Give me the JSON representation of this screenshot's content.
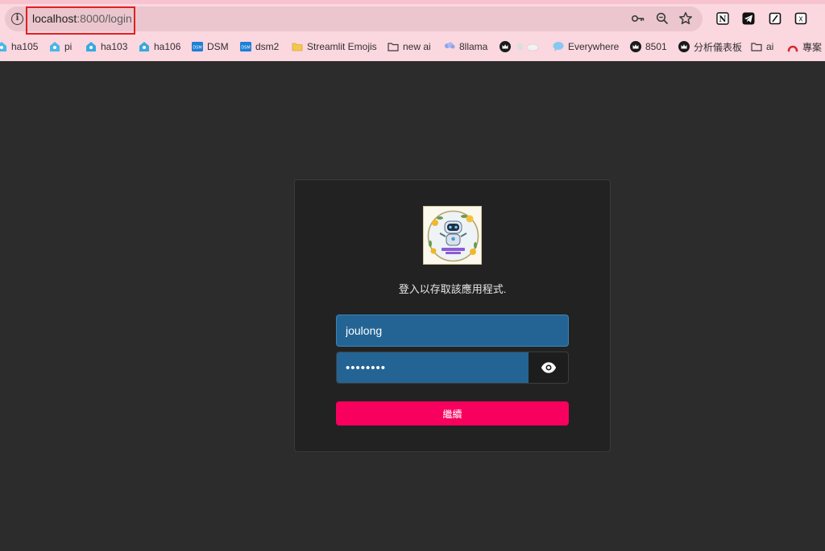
{
  "browser": {
    "url_host": "localhost",
    "url_rest": ":8000/login"
  },
  "bookmarks": [
    {
      "label": "ha105",
      "icon": "home-assistant-icon"
    },
    {
      "label": "pi",
      "icon": "home-assistant-icon"
    },
    {
      "label": "ha103",
      "icon": "home-assistant-icon"
    },
    {
      "label": "ha106",
      "icon": "home-assistant-icon"
    },
    {
      "label": "DSM",
      "icon": "dsm-icon"
    },
    {
      "label": "dsm2",
      "icon": "dsm-icon"
    },
    {
      "label": "Streamlit Emojis",
      "icon": "folder-yellow-icon"
    },
    {
      "label": "new ai",
      "icon": "folder-icon"
    },
    {
      "label": "8llama",
      "icon": "cloud-icon"
    },
    {
      "label": "",
      "icon": "crown-icon"
    },
    {
      "label": "Everywhere",
      "icon": "chat-bubble-icon"
    },
    {
      "label": "8501",
      "icon": "crown-icon"
    },
    {
      "label": "分析儀表板",
      "icon": "crown-icon"
    },
    {
      "label": "ai",
      "icon": "folder-icon"
    },
    {
      "label": "專案",
      "icon": "arc-icon"
    }
  ],
  "login": {
    "prompt": "登入以存取該應用程式.",
    "username_value": "joulong",
    "password_value": "••••••••",
    "continue_label": "繼續"
  },
  "colors": {
    "page_bg": "#2c2c2c",
    "card_bg": "#222222",
    "input_bg": "#246494",
    "button_bg": "#f8005e",
    "chrome_bg": "#fbd7e0",
    "highlight": "#e0201f"
  }
}
